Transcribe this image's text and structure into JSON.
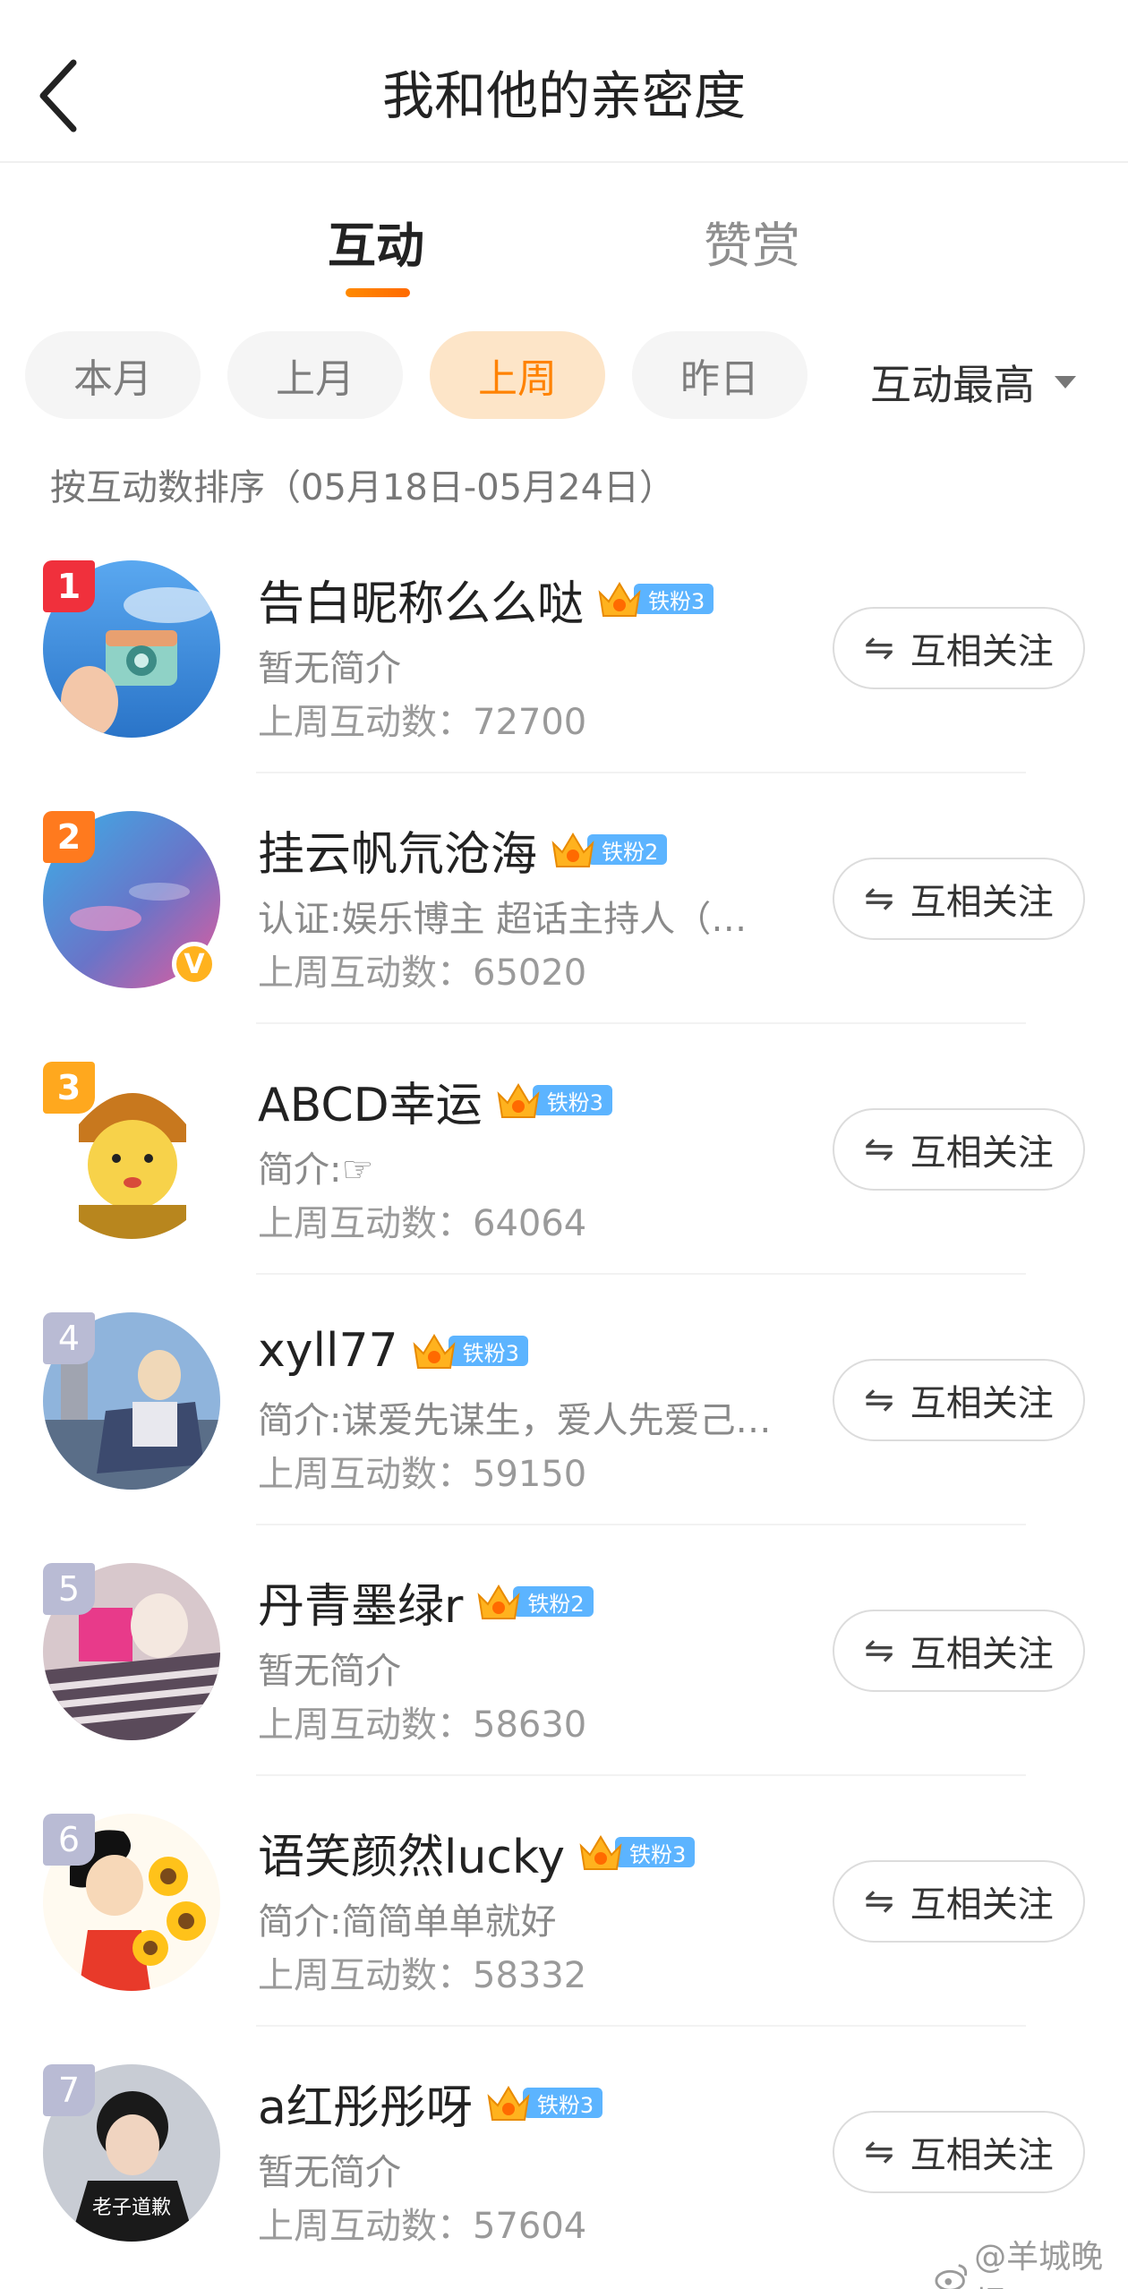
{
  "header": {
    "title": "我和他的亲密度"
  },
  "tabs": [
    {
      "label": "互动",
      "active": true
    },
    {
      "label": "赞赏",
      "active": false
    }
  ],
  "filters": {
    "chips": [
      {
        "label": "本月"
      },
      {
        "label": "上月"
      },
      {
        "label": "上周",
        "active": true
      },
      {
        "label": "昨日"
      }
    ],
    "sort": "互动最高"
  },
  "sort_note": "按互动数排序（05月18日-05月24日）",
  "colors": {
    "accent": "#ff8200",
    "fan_badge": "#5cb4ff",
    "rank1": "#f0303c",
    "rank2": "#ff7a1e",
    "rank3": "#ffa81e",
    "rank_other": "#b9bbd4"
  },
  "users": [
    {
      "rank": "1",
      "name": "告白昵称么么哒",
      "fan_level": "铁粉3",
      "bio": "暂无简介",
      "count": "上周互动数：72700",
      "follow": "互相关注"
    },
    {
      "rank": "2",
      "name": "挂云帆氘沧海",
      "fan_level": "铁粉2",
      "bio": "认证:娱乐博主 超话主持人（…",
      "count": "上周互动数：65020",
      "follow": "互相关注",
      "verified_badge": "V"
    },
    {
      "rank": "3",
      "name": "ABCD幸运",
      "fan_level": "铁粉3",
      "bio": "简介:☞",
      "count": "上周互动数：64064",
      "follow": "互相关注"
    },
    {
      "rank": "4",
      "name": "xyll77",
      "fan_level": "铁粉3",
      "bio": "简介:谋爱先谋生，爱人先爱己…",
      "count": "上周互动数：59150",
      "follow": "互相关注"
    },
    {
      "rank": "5",
      "name": "丹青墨绿r",
      "fan_level": "铁粉2",
      "bio": "暂无简介",
      "count": "上周互动数：58630",
      "follow": "互相关注"
    },
    {
      "rank": "6",
      "name": "语笑颜然lucky",
      "fan_level": "铁粉3",
      "bio": "简介:简简单单就好",
      "count": "上周互动数：58332",
      "follow": "互相关注"
    },
    {
      "rank": "7",
      "name": "a红彤彤呀",
      "fan_level": "铁粉3",
      "bio": "暂无简介",
      "count": "上周互动数：57604",
      "follow": "互相关注",
      "avatar_caption": "老子道歉"
    }
  ],
  "follow_icon": "⇋",
  "watermark": "@羊城晚报"
}
